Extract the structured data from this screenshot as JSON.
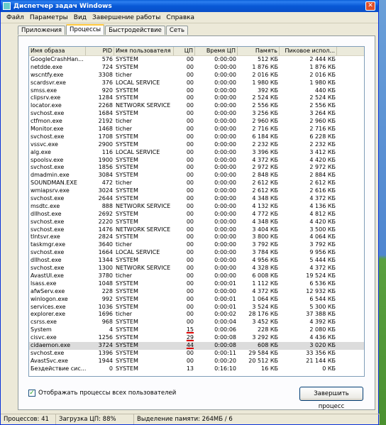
{
  "window": {
    "title": "Диспетчер задач Windows",
    "close_glyph": "✕"
  },
  "menu": [
    "Файл",
    "Параметры",
    "Вид",
    "Завершение работы",
    "Справка"
  ],
  "tabs": [
    "Приложения",
    "Процессы",
    "Быстродействие",
    "Сеть"
  ],
  "columns": [
    "Имя образа",
    "PID",
    "Имя пользователя",
    "ЦП",
    "Время ЦП",
    "Память",
    "Пиковое испол..."
  ],
  "rows": [
    [
      "GoogleCrashHan...",
      "576",
      "SYSTEM",
      "00",
      "0:00:00",
      "512 КБ",
      "2 444 КБ"
    ],
    [
      "netdde.exe",
      "724",
      "SYSTEM",
      "00",
      "0:00:00",
      "1 876 КБ",
      "1 876 КБ"
    ],
    [
      "wscntfy.exe",
      "3308",
      "ticher",
      "00",
      "0:00:00",
      "2 016 КБ",
      "2 016 КБ"
    ],
    [
      "scardsvr.exe",
      "376",
      "LOCAL SERVICE",
      "00",
      "0:00:00",
      "1 980 КБ",
      "1 980 КБ"
    ],
    [
      "smss.exe",
      "920",
      "SYSTEM",
      "00",
      "0:00:00",
      "392 КБ",
      "440 КБ"
    ],
    [
      "clipsrv.exe",
      "1284",
      "SYSTEM",
      "00",
      "0:00:00",
      "2 524 КБ",
      "2 524 КБ"
    ],
    [
      "locator.exe",
      "2268",
      "NETWORK SERVICE",
      "00",
      "0:00:00",
      "2 556 КБ",
      "2 556 КБ"
    ],
    [
      "svchost.exe",
      "1684",
      "SYSTEM",
      "00",
      "0:00:00",
      "3 256 КБ",
      "3 264 КБ"
    ],
    [
      "ctfmon.exe",
      "2192",
      "ticher",
      "00",
      "0:00:00",
      "2 960 КБ",
      "2 960 КБ"
    ],
    [
      "Monitor.exe",
      "1468",
      "ticher",
      "00",
      "0:00:00",
      "2 716 КБ",
      "2 716 КБ"
    ],
    [
      "svchost.exe",
      "1708",
      "SYSTEM",
      "00",
      "0:00:00",
      "6 184 КБ",
      "6 228 КБ"
    ],
    [
      "vssvc.exe",
      "2900",
      "SYSTEM",
      "00",
      "0:00:00",
      "2 232 КБ",
      "2 232 КБ"
    ],
    [
      "alg.exe",
      "116",
      "LOCAL SERVICE",
      "00",
      "0:00:00",
      "3 396 КБ",
      "3 412 КБ"
    ],
    [
      "spoolsv.exe",
      "1900",
      "SYSTEM",
      "00",
      "0:00:00",
      "4 372 КБ",
      "4 420 КБ"
    ],
    [
      "svchost.exe",
      "1856",
      "SYSTEM",
      "00",
      "0:00:00",
      "2 972 КБ",
      "2 972 КБ"
    ],
    [
      "dmadmin.exe",
      "3084",
      "SYSTEM",
      "00",
      "0:00:00",
      "2 848 КБ",
      "2 884 КБ"
    ],
    [
      "SOUNDMAN.EXE",
      "472",
      "ticher",
      "00",
      "0:00:00",
      "2 612 КБ",
      "2 612 КБ"
    ],
    [
      "wmiapsrv.exe",
      "3024",
      "SYSTEM",
      "00",
      "0:00:00",
      "2 612 КБ",
      "2 616 КБ"
    ],
    [
      "svchost.exe",
      "2644",
      "SYSTEM",
      "00",
      "0:00:00",
      "4 348 КБ",
      "4 372 КБ"
    ],
    [
      "msdtc.exe",
      "888",
      "NETWORK SERVICE",
      "00",
      "0:00:00",
      "4 132 КБ",
      "4 136 КБ"
    ],
    [
      "dllhost.exe",
      "2692",
      "SYSTEM",
      "00",
      "0:00:00",
      "4 772 КБ",
      "4 812 КБ"
    ],
    [
      "svchost.exe",
      "2220",
      "SYSTEM",
      "00",
      "0:00:00",
      "4 348 КБ",
      "4 420 КБ"
    ],
    [
      "svchost.exe",
      "1476",
      "NETWORK SERVICE",
      "00",
      "0:00:00",
      "3 404 КБ",
      "3 500 КБ"
    ],
    [
      "tlntsvr.exe",
      "2824",
      "SYSTEM",
      "00",
      "0:00:00",
      "3 800 КБ",
      "4 064 КБ"
    ],
    [
      "taskmgr.exe",
      "3640",
      "ticher",
      "00",
      "0:00:00",
      "3 792 КБ",
      "3 792 КБ"
    ],
    [
      "svchost.exe",
      "1664",
      "LOCAL SERVICE",
      "00",
      "0:00:00",
      "3 784 КБ",
      "9 956 КБ"
    ],
    [
      "dllhost.exe",
      "1344",
      "SYSTEM",
      "00",
      "0:00:00",
      "4 956 КБ",
      "5 444 КБ"
    ],
    [
      "svchost.exe",
      "1300",
      "NETWORK SERVICE",
      "00",
      "0:00:00",
      "4 328 КБ",
      "4 372 КБ"
    ],
    [
      "AvastUI.exe",
      "3780",
      "ticher",
      "00",
      "0:00:00",
      "6 008 КБ",
      "19 524 КБ"
    ],
    [
      "lsass.exe",
      "1048",
      "SYSTEM",
      "00",
      "0:00:01",
      "1 112 КБ",
      "6 536 КБ"
    ],
    [
      "afwServ.exe",
      "228",
      "SYSTEM",
      "00",
      "0:00:00",
      "4 372 КБ",
      "12 932 КБ"
    ],
    [
      "winlogon.exe",
      "992",
      "SYSTEM",
      "00",
      "0:00:01",
      "1 064 КБ",
      "6 544 КБ"
    ],
    [
      "services.exe",
      "1036",
      "SYSTEM",
      "00",
      "0:00:01",
      "3 524 КБ",
      "5 300 КБ"
    ],
    [
      "explorer.exe",
      "1696",
      "ticher",
      "00",
      "0:00:02",
      "28 176 КБ",
      "37 388 КБ"
    ],
    [
      "csrss.exe",
      "968",
      "SYSTEM",
      "00",
      "0:00:04",
      "3 452 КБ",
      "4 392 КБ"
    ],
    [
      "System",
      "4",
      "SYSTEM",
      "15",
      "0:00:06",
      "228 КБ",
      "2 080 КБ"
    ],
    [
      "cisvc.exe",
      "1256",
      "SYSTEM",
      "29",
      "0:00:08",
      "3 292 КБ",
      "4 436 КБ"
    ],
    [
      "cidaemon.exe",
      "3724",
      "SYSTEM",
      "44",
      "0:00:08",
      "608 КБ",
      "3 020 КБ"
    ],
    [
      "svchost.exe",
      "1396",
      "SYSTEM",
      "00",
      "0:00:11",
      "29 584 КБ",
      "33 356 КБ"
    ],
    [
      "AvastSvc.exe",
      "1944",
      "SYSTEM",
      "00",
      "0:00:20",
      "20 512 КБ",
      "21 144 КБ"
    ],
    [
      "Бездействие сис...",
      "0",
      "SYSTEM",
      "13",
      "0:16:10",
      "16 КБ",
      "0 КБ"
    ]
  ],
  "show_all_users_label": "Отображать процессы всех пользователей",
  "show_all_users_checked": true,
  "end_process_label": "Завершить процесс",
  "status": {
    "processes": "Процессов: 41",
    "cpu": "Загрузка ЦП: 88%",
    "commit": "Выделение памяти: 264МБ / 6"
  }
}
